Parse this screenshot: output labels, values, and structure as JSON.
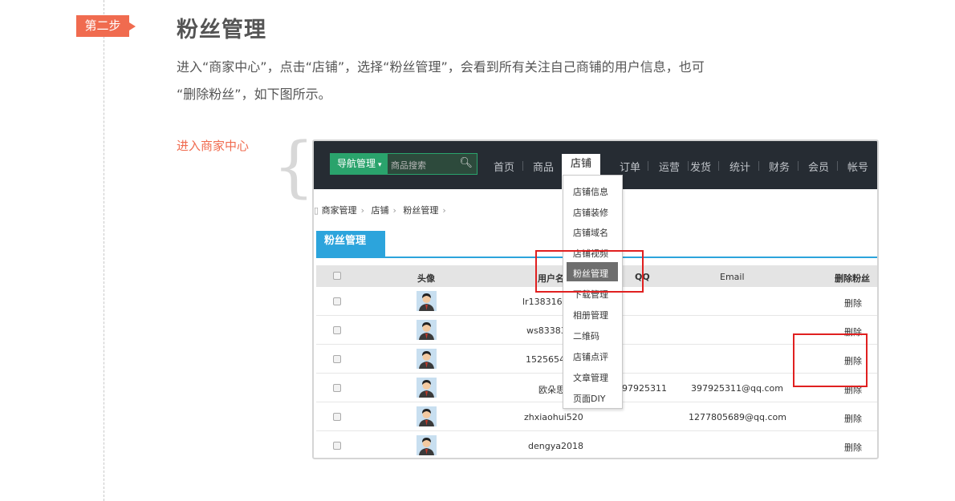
{
  "step": {
    "label": "第二步",
    "title": "粉丝管理"
  },
  "description": {
    "line1": "进入“商家中心”，点击“店铺”，选择“粉丝管理”，会看到所有关注自己商铺的用户信息，也可",
    "line2": "“删除粉丝”，如下图所示。"
  },
  "side_label": "进入商家中心",
  "screenshot": {
    "nav_button": "导航管理",
    "search_placeholder": "商品搜索",
    "menu": [
      "首页",
      "商品",
      "店铺",
      "订单",
      "运营",
      "发货",
      "统计",
      "财务",
      "会员",
      "帐号"
    ],
    "active_menu": "店铺",
    "breadcrumb": [
      "商家管理",
      "店铺",
      "粉丝管理"
    ],
    "tab": "粉丝管理",
    "dropdown": [
      "店铺信息",
      "店铺装修",
      "店铺域名",
      "店铺视频",
      "粉丝管理",
      "下载管理",
      "相册管理",
      "二维码",
      "店铺点评",
      "文章管理",
      "页面DIY"
    ],
    "dropdown_active": "粉丝管理",
    "table": {
      "headers": {
        "avatar": "头像",
        "username": "用户名",
        "qq": "QQ",
        "email": "Email",
        "delete": "删除粉丝"
      },
      "rows": [
        {
          "username": "lr13831656",
          "qq": "",
          "email": "",
          "delete": "删除"
        },
        {
          "username": "ws833833",
          "qq": "",
          "email": "",
          "delete": "删除"
        },
        {
          "username": "15256549",
          "qq": "",
          "email": "",
          "delete": "删除"
        },
        {
          "username": "欧朵思",
          "qq": "397925311",
          "email": "397925311@qq.com",
          "delete": "删除"
        },
        {
          "username": "zhxiaohui520",
          "qq": "",
          "email": "1277805689@qq.com",
          "delete": "删除"
        },
        {
          "username": "dengya2018",
          "qq": "",
          "email": "",
          "delete": "删除"
        }
      ]
    }
  },
  "colors": {
    "accent": "#f06b4f",
    "tab": "#2ca4dc",
    "nav_green": "#2aa36c",
    "highlight": "#e02020",
    "topbar": "#262c33"
  }
}
